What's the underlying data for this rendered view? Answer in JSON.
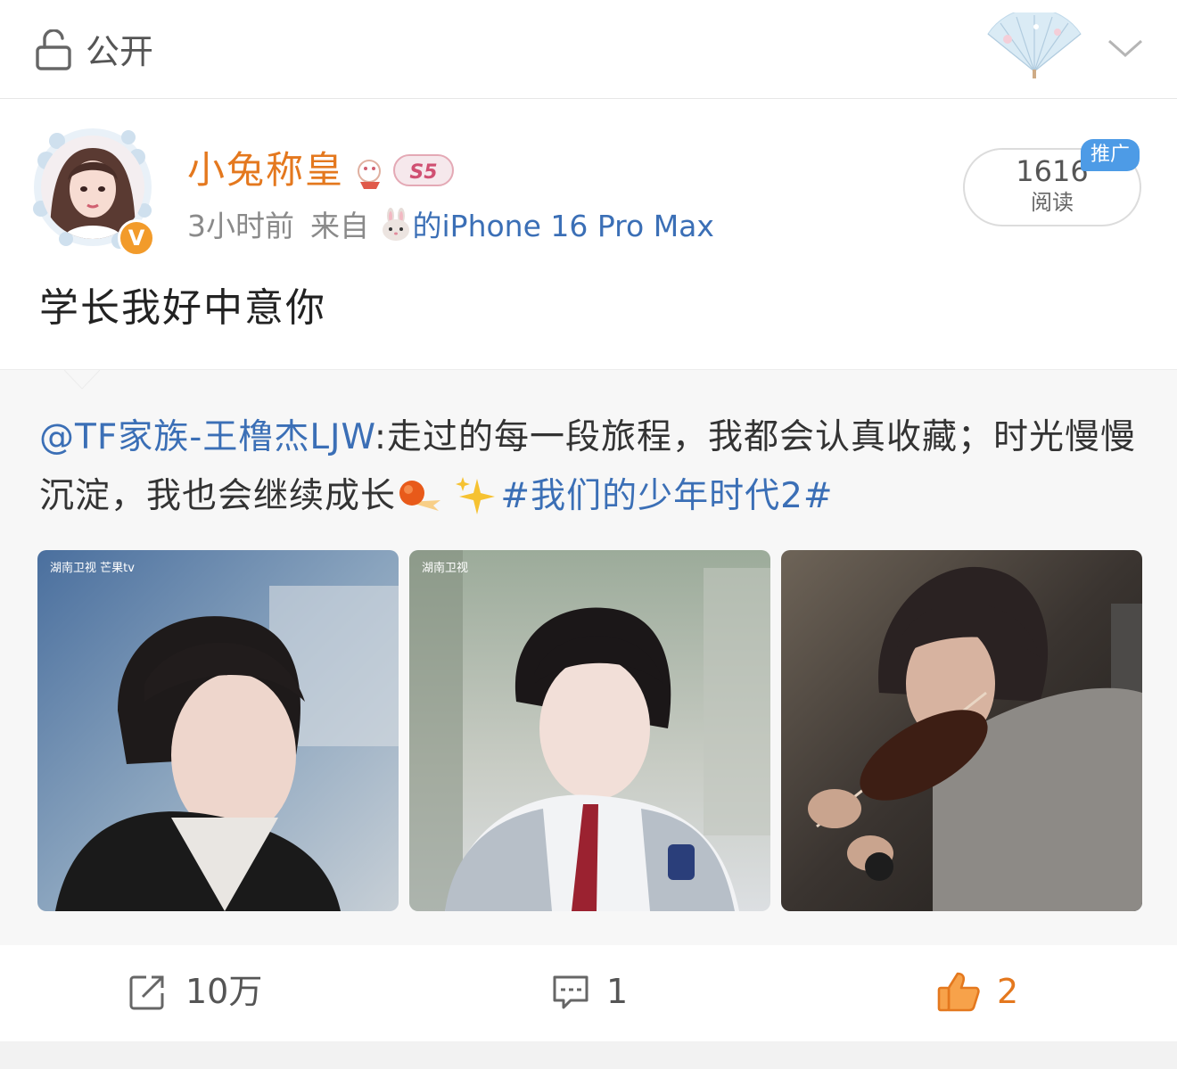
{
  "header": {
    "visibility_label": "公开",
    "icons": [
      "lock-icon",
      "fan-decoration-icon",
      "chevron-down-icon"
    ]
  },
  "post": {
    "username": "小兔称皇",
    "rank_badge": "S5",
    "time": "3小时前",
    "source_prefix": "来自",
    "device": "的iPhone 16 Pro Max",
    "verified_mark": "V",
    "reads": {
      "count": "1616",
      "label": "阅读",
      "promo": "推广"
    },
    "text": "学长我好中意你",
    "accent_color": "#e4781e",
    "link_color": "#3b6fb6"
  },
  "repost": {
    "mention": "@TF家族-王橹杰LJW",
    "text_part1": ":走过的每一段旅程，我都会认真收藏；时光慢慢沉淀，我也会继续成长",
    "hashtag": "#我们的少年时代2#",
    "images": [
      {
        "watermark": "湖南卫视 芒果tv"
      },
      {
        "watermark": "湖南卫视"
      },
      {
        "watermark": ""
      }
    ]
  },
  "actions": {
    "repost": {
      "count": "10万",
      "icon": "share-icon"
    },
    "comment": {
      "count": "1",
      "icon": "comment-icon"
    },
    "like": {
      "count": "2",
      "icon": "thumbs-up-icon"
    }
  }
}
